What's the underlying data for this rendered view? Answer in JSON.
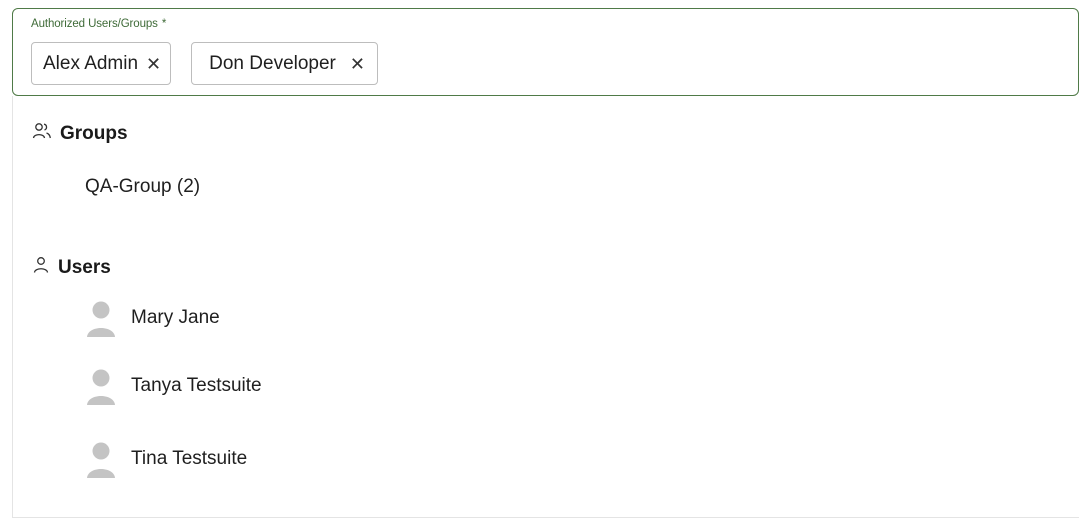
{
  "field": {
    "label": "Authorized Users/Groups",
    "required_marker": "*",
    "chips": [
      {
        "label": "Alex Admin",
        "remove_glyph": "✕"
      },
      {
        "label": "Don Developer",
        "remove_glyph": "✕"
      }
    ]
  },
  "dropdown": {
    "groups_heading": "Groups",
    "groups_icon": "users-group-icon",
    "groups": [
      "QA-Group (2)"
    ],
    "users_heading": "Users",
    "users_icon": "user-icon",
    "users": [
      {
        "name": "Mary Jane",
        "avatar": "avatar-placeholder-icon"
      },
      {
        "name": "Tanya Testsuite",
        "avatar": "avatar-placeholder-icon"
      },
      {
        "name": "Tina Testsuite",
        "avatar": "avatar-placeholder-icon"
      }
    ]
  },
  "colors": {
    "field_border": "#4f7a47",
    "label_text": "#3f6b38",
    "chip_border": "#bdbdbd",
    "avatar_gray": "#c4c4c4"
  }
}
